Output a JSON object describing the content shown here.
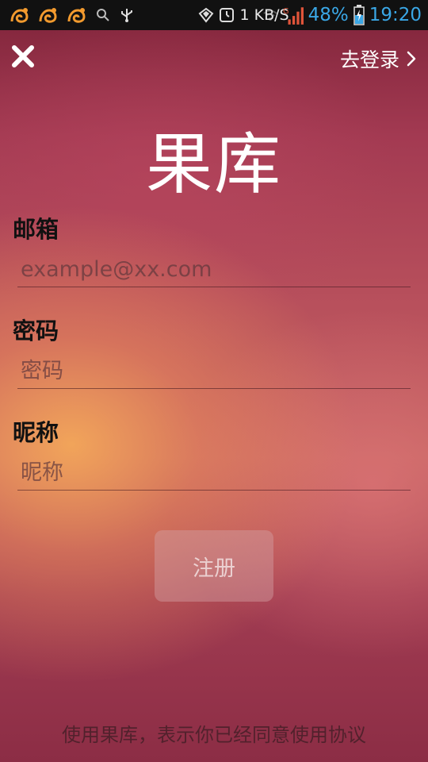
{
  "status_bar": {
    "icons": [
      "uc-browser-icon",
      "uc-browser-icon",
      "uc-browser-icon",
      "search-icon",
      "usb-icon",
      "vpn-icon",
      "clock-icon",
      "wifi-icon",
      "signal-icon",
      "battery-charging-icon"
    ],
    "network_speed": "1 KB/S",
    "network_type": "G",
    "battery": "48%",
    "time": "19:20"
  },
  "header": {
    "close_icon": "close-icon",
    "login_link_label": "去登录",
    "login_chevron_icon": "chevron-right-icon"
  },
  "app": {
    "title": "果库"
  },
  "form": {
    "email": {
      "label": "邮箱",
      "placeholder": "example@xx.com",
      "value": ""
    },
    "password": {
      "label": "密码",
      "placeholder": "密码",
      "value": ""
    },
    "nickname": {
      "label": "昵称",
      "placeholder": "昵称",
      "value": ""
    },
    "submit_label": "注册"
  },
  "footer": {
    "agreement_text": "使用果库，表示你已经同意使用协议"
  },
  "colors": {
    "accent_blue": "#3aa7e6",
    "title_white": "#ffffff",
    "label_dark": "#111111"
  }
}
